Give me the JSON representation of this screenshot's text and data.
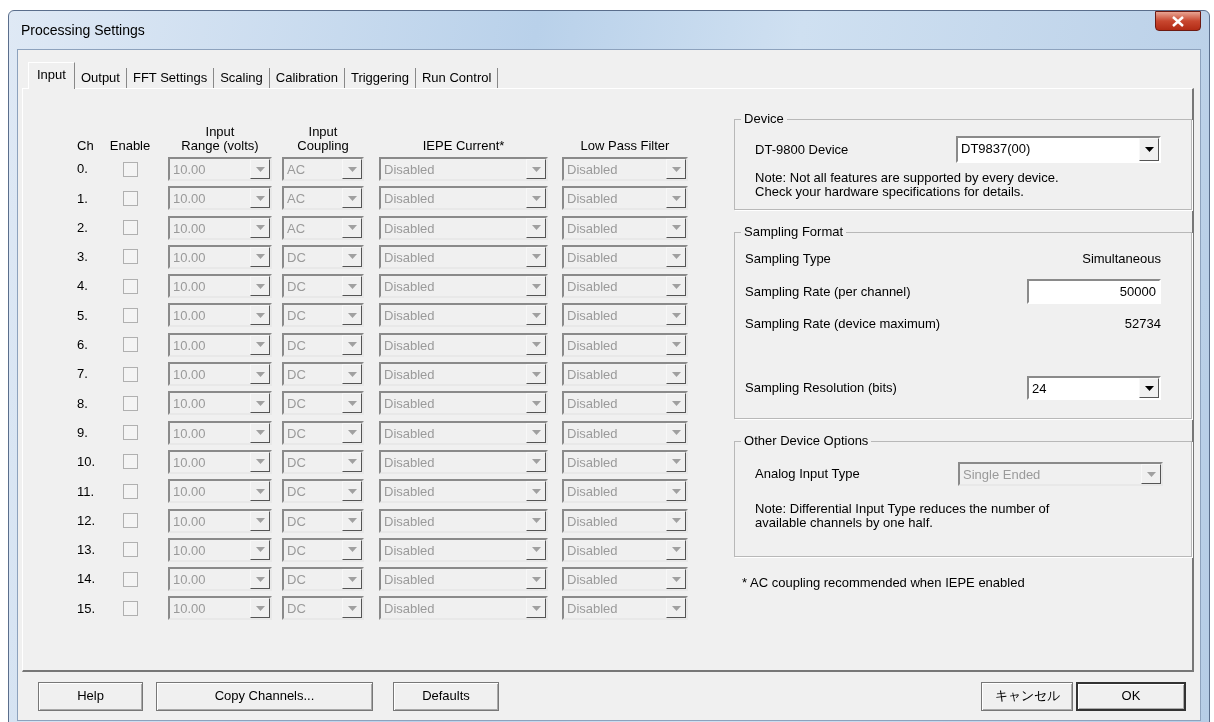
{
  "window": {
    "title": "Processing Settings"
  },
  "tabs": [
    {
      "label": "Input",
      "selected": true
    },
    {
      "label": "Output",
      "selected": false
    },
    {
      "label": "FFT Settings",
      "selected": false
    },
    {
      "label": "Scaling",
      "selected": false
    },
    {
      "label": "Calibration",
      "selected": false
    },
    {
      "label": "Triggering",
      "selected": false
    },
    {
      "label": "Run Control",
      "selected": false
    }
  ],
  "channel_table": {
    "columns": [
      "Ch",
      "Enable",
      "Input\nRange (volts)",
      "Input\nCoupling",
      "IEPE Current*",
      "Low Pass Filter"
    ],
    "rows": [
      {
        "ch": "0.",
        "checked": false,
        "disabled": true,
        "range": "10.00",
        "coupling": "AC",
        "iepe": "Disabled",
        "low_pass_filter": "Disabled"
      },
      {
        "ch": "1.",
        "checked": false,
        "disabled": true,
        "range": "10.00",
        "coupling": "AC",
        "iepe": "Disabled",
        "low_pass_filter": "Disabled"
      },
      {
        "ch": "2.",
        "checked": false,
        "disabled": true,
        "range": "10.00",
        "coupling": "AC",
        "iepe": "Disabled",
        "low_pass_filter": "Disabled"
      },
      {
        "ch": "3.",
        "checked": false,
        "disabled": true,
        "range": "10.00",
        "coupling": "DC",
        "iepe": "Disabled",
        "low_pass_filter": "Disabled"
      },
      {
        "ch": "4.",
        "checked": false,
        "disabled": true,
        "range": "10.00",
        "coupling": "DC",
        "iepe": "Disabled",
        "low_pass_filter": "Disabled"
      },
      {
        "ch": "5.",
        "checked": false,
        "disabled": true,
        "range": "10.00",
        "coupling": "DC",
        "iepe": "Disabled",
        "low_pass_filter": "Disabled"
      },
      {
        "ch": "6.",
        "checked": false,
        "disabled": true,
        "range": "10.00",
        "coupling": "DC",
        "iepe": "Disabled",
        "low_pass_filter": "Disabled"
      },
      {
        "ch": "7.",
        "checked": false,
        "disabled": true,
        "range": "10.00",
        "coupling": "DC",
        "iepe": "Disabled",
        "low_pass_filter": "Disabled"
      },
      {
        "ch": "8.",
        "checked": false,
        "disabled": true,
        "range": "10.00",
        "coupling": "DC",
        "iepe": "Disabled",
        "low_pass_filter": "Disabled"
      },
      {
        "ch": "9.",
        "checked": false,
        "disabled": true,
        "range": "10.00",
        "coupling": "DC",
        "iepe": "Disabled",
        "low_pass_filter": "Disabled"
      },
      {
        "ch": "10.",
        "checked": false,
        "disabled": true,
        "range": "10.00",
        "coupling": "DC",
        "iepe": "Disabled",
        "low_pass_filter": "Disabled"
      },
      {
        "ch": "11.",
        "checked": false,
        "disabled": true,
        "range": "10.00",
        "coupling": "DC",
        "iepe": "Disabled",
        "low_pass_filter": "Disabled"
      },
      {
        "ch": "12.",
        "checked": false,
        "disabled": true,
        "range": "10.00",
        "coupling": "DC",
        "iepe": "Disabled",
        "low_pass_filter": "Disabled"
      },
      {
        "ch": "13.",
        "checked": false,
        "disabled": true,
        "range": "10.00",
        "coupling": "DC",
        "iepe": "Disabled",
        "low_pass_filter": "Disabled"
      },
      {
        "ch": "14.",
        "checked": false,
        "disabled": true,
        "range": "10.00",
        "coupling": "DC",
        "iepe": "Disabled",
        "low_pass_filter": "Disabled"
      },
      {
        "ch": "15.",
        "checked": false,
        "disabled": true,
        "range": "10.00",
        "coupling": "DC",
        "iepe": "Disabled",
        "low_pass_filter": "Disabled"
      }
    ]
  },
  "device": {
    "title": "Device",
    "label": "DT-9800 Device",
    "value": "DT9837(00)",
    "note": "Note: Not all features are supported by every device.\nCheck your hardware specifications for details."
  },
  "sampling_format": {
    "title": "Sampling Format",
    "rows": [
      {
        "kind": "text",
        "label": "Sampling Type",
        "value": "Simultaneous"
      },
      {
        "kind": "input",
        "label": "Sampling Rate (per channel)",
        "value": "50000"
      },
      {
        "kind": "text",
        "label": "Sampling Rate (device maximum)",
        "value": "52734"
      },
      {
        "kind": "select",
        "label": "Sampling Resolution (bits)",
        "value": "24"
      }
    ]
  },
  "other_device_options": {
    "title": "Other Device Options",
    "label": "Analog Input Type",
    "value": "Single Ended",
    "disabled": true,
    "note": "Note: Differential Input Type reduces the number of\navailable channels by one half."
  },
  "footnote": "* AC coupling recommended when IEPE enabled",
  "buttons_left": [
    {
      "label": "Help",
      "default": false
    },
    {
      "label": "Copy Channels...",
      "default": false
    },
    {
      "label": "Defaults",
      "default": false
    }
  ],
  "buttons_right": [
    {
      "label": "キャンセル",
      "default": false
    },
    {
      "label": "OK",
      "default": true
    }
  ]
}
